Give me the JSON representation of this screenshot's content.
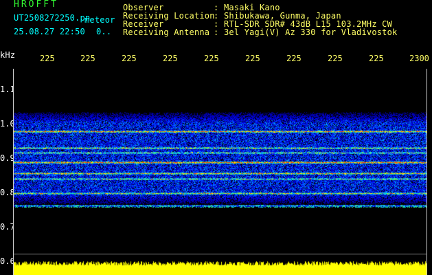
{
  "header": {
    "title": "HROFFT",
    "filename": "UT2508272250.pn",
    "tag": "meteor",
    "datetime": "25.08.27 22:50",
    "count": "0..",
    "meta": [
      {
        "label": "Observer",
        "value": "Masaki Kano"
      },
      {
        "label": "Receiving Location",
        "value": "Shibukawa, Gunma, Japan"
      },
      {
        "label": "Receiver",
        "value": "RTL-SDR SDR# 43dB L15 103.2MHz CW"
      },
      {
        "label": "Receiving Antenna",
        "value": "3el Yagi(V) Az 330 for Vladivostok"
      }
    ]
  },
  "axes": {
    "y_unit": "kHz",
    "y_ticks": [
      "1.1",
      "1.0",
      "0.9",
      "0.8",
      "0.7",
      "0.6"
    ],
    "x_ticks": [
      "225",
      "225",
      "225",
      "225",
      "225",
      "225",
      "225",
      "225",
      "225",
      "2300"
    ]
  },
  "colors": {
    "background": "#000000",
    "noise_low": "#0000aa",
    "noise_mid": "#0066ff",
    "signal": "#00ffcc",
    "strong": "#ffff00",
    "peak": "#ff3300",
    "power_bar": "#ffff00"
  }
}
